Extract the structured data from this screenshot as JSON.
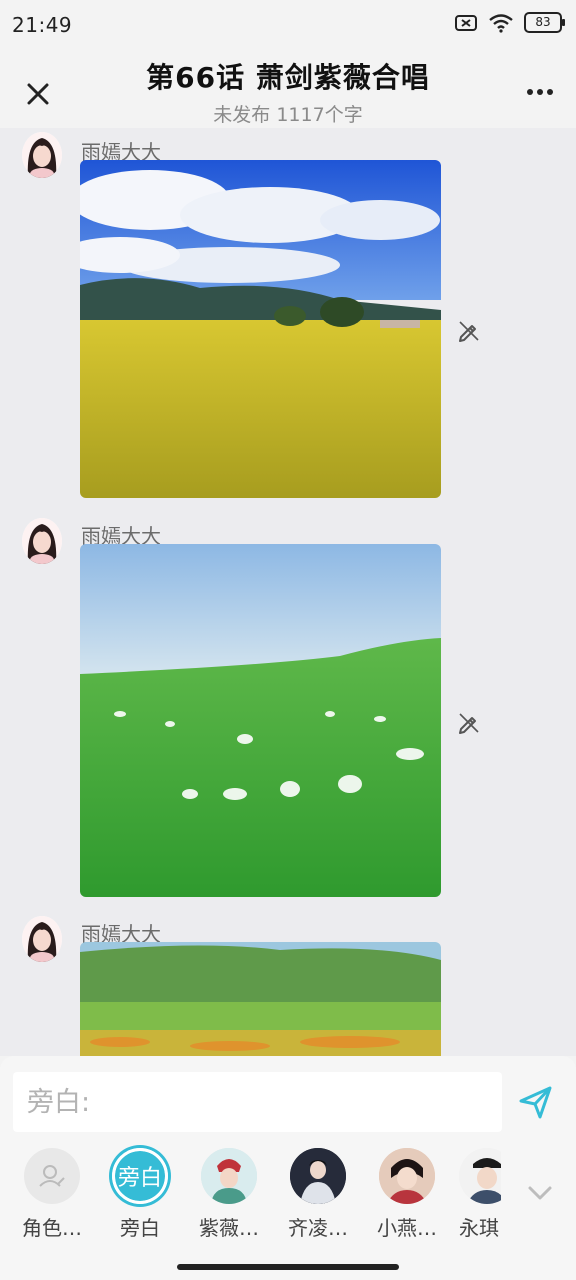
{
  "status": {
    "time": "21:49",
    "battery": "83"
  },
  "nav": {
    "title": "第66话 萧剑紫薇合唱",
    "subtitle": "未发布 1117个字"
  },
  "messages": [
    {
      "sender": "雨嫣大大",
      "image": "yellow-flower-field-photo"
    },
    {
      "sender": "雨嫣大大",
      "image": "green-grass-meadow-photo"
    },
    {
      "sender": "雨嫣大大",
      "image": "orange-flower-grassland-photo"
    }
  ],
  "composer": {
    "placeholder": "旁白:"
  },
  "roles": [
    {
      "label": "角色…",
      "icon": "add-role-icon"
    },
    {
      "label": "旁白",
      "avatar_text": "旁白",
      "selected": true
    },
    {
      "label": "紫薇…"
    },
    {
      "label": "齐凌…"
    },
    {
      "label": "小燕…"
    },
    {
      "label": "永琪"
    }
  ],
  "colors": {
    "accent": "#35bcd6",
    "chat_bg": "#ececef"
  }
}
